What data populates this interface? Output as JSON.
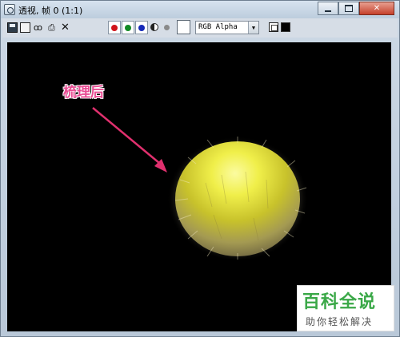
{
  "window": {
    "title": "透视, 帧 0 (1:1)"
  },
  "title_buttons": {
    "close_label": "✕"
  },
  "toolbar": {
    "icons": [
      "save-icon",
      "copy-icon",
      "clone-icon",
      "print-icon",
      "clear-icon"
    ],
    "clone_glyph": "ꝏ",
    "print_glyph": "⎙",
    "clear_glyph": "✕",
    "channels": [
      {
        "name": "red",
        "color": "#d0141a"
      },
      {
        "name": "green",
        "color": "#138a24"
      },
      {
        "name": "blue",
        "color": "#1529b8"
      }
    ],
    "channel_select_value": "RGB Alpha",
    "select_arrow": "▼"
  },
  "viewport": {
    "annotation_text": "梳理后",
    "annotation_color": "#e84c93",
    "background": "#000000"
  },
  "watermark": {
    "logo_text": "百科全说",
    "subtitle": "助你轻松解决"
  }
}
